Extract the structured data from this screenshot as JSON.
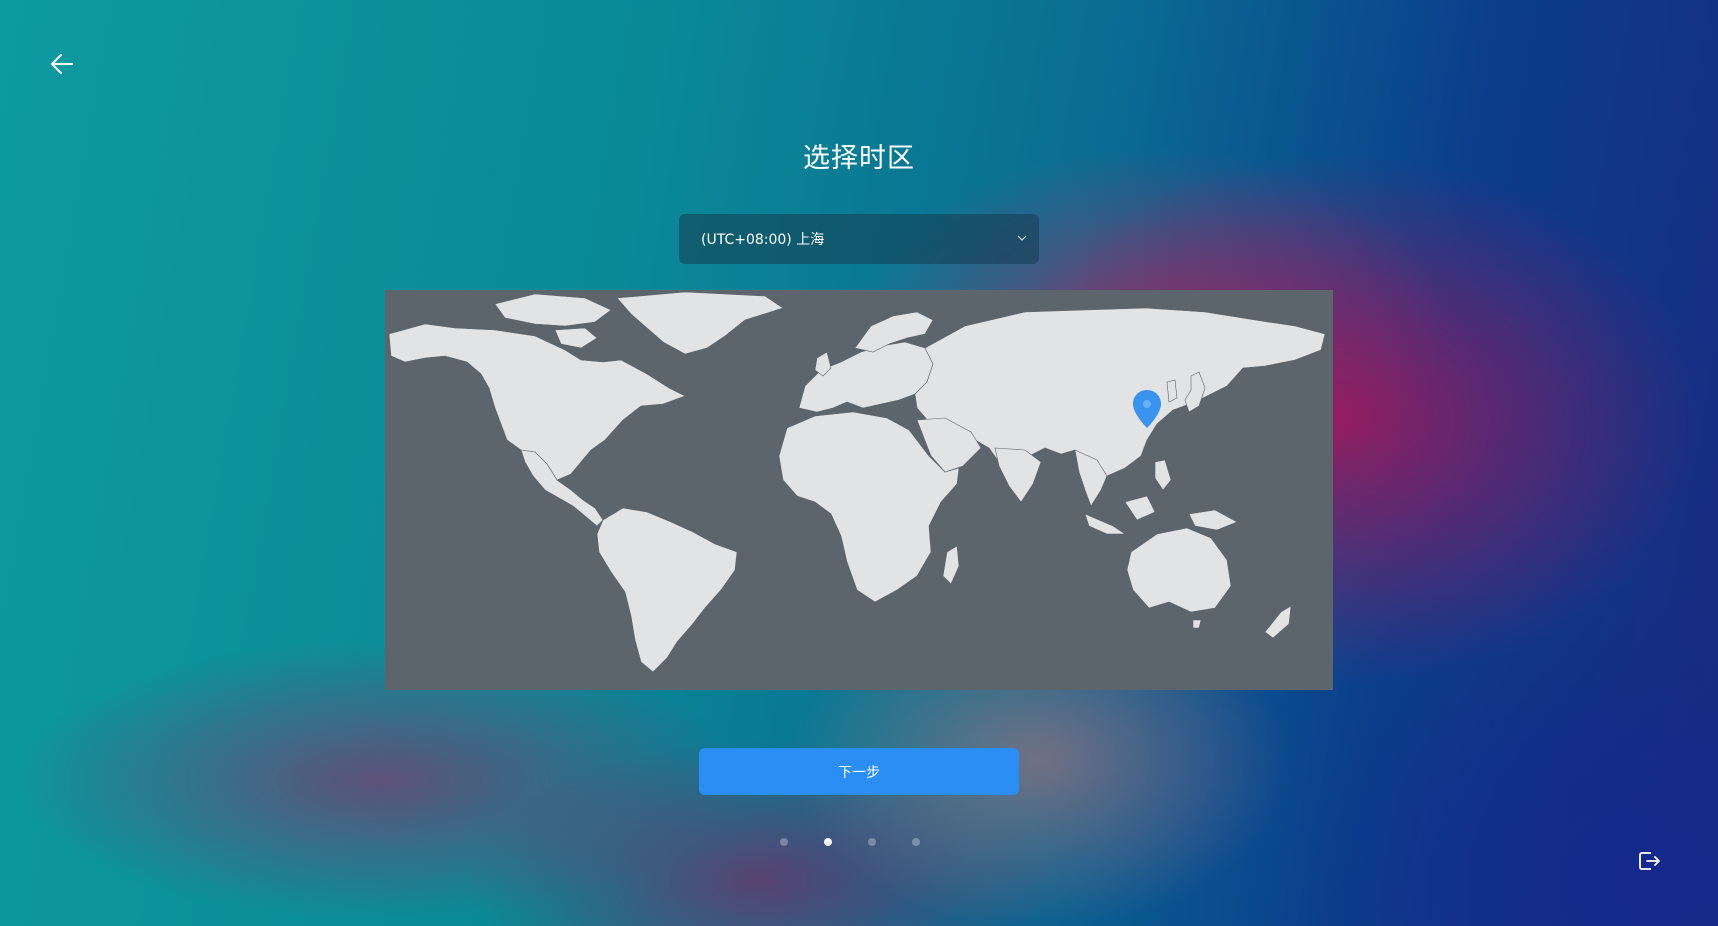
{
  "page": {
    "title": "选择时区"
  },
  "timezone_select": {
    "selected": "(UTC+08:00) 上海"
  },
  "map": {
    "marker_icon": "location-pin-icon",
    "marker_color": "#3b93f0",
    "selected_city": "上海"
  },
  "actions": {
    "next_label": "下一步",
    "back_icon": "arrow-left-icon",
    "exit_icon": "exit-icon"
  },
  "pagination": {
    "total": 4,
    "current": 2
  },
  "colors": {
    "accent": "#2b8ef5",
    "map_ocean": "#5d656c",
    "map_land": "#e2e3e5"
  }
}
